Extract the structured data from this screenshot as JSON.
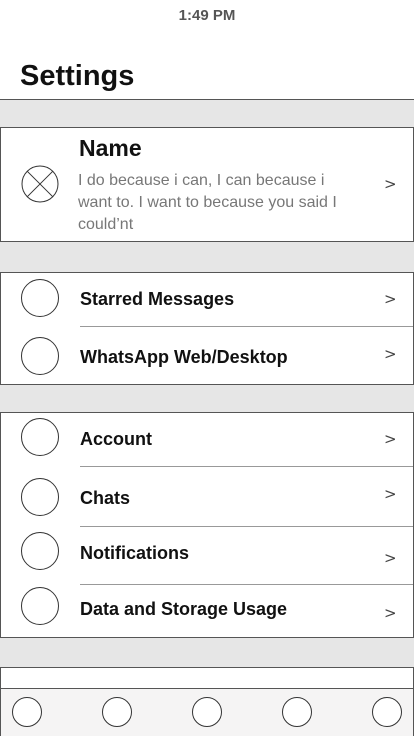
{
  "status_bar": {
    "time": "1:49 PM"
  },
  "header": {
    "title": "Settings"
  },
  "profile": {
    "name": "Name",
    "status": "I do because i can, I can because i want to. I want to because  you said I could’nt",
    "chevron": ">",
    "avatar_icon": "x-circle-icon"
  },
  "group1": {
    "items": [
      {
        "label": "Starred Messages",
        "chevron": ">"
      },
      {
        "label": "WhatsApp Web/Desktop",
        "chevron": ">"
      }
    ]
  },
  "group2": {
    "items": [
      {
        "label": "Account",
        "chevron": ">"
      },
      {
        "label": "Chats",
        "chevron": ">"
      },
      {
        "label": "Notifications",
        "chevron": ">"
      },
      {
        "label": "Data and Storage Usage",
        "chevron": ">"
      }
    ]
  },
  "tabbar": {
    "tabs": [
      "tab-1-icon",
      "tab-2-icon",
      "tab-3-icon",
      "tab-4-icon",
      "tab-5-icon"
    ]
  },
  "colors": {
    "background": "#e6e6e6",
    "surface": "#ffffff",
    "border": "#555555",
    "secondary_text": "#777777"
  }
}
